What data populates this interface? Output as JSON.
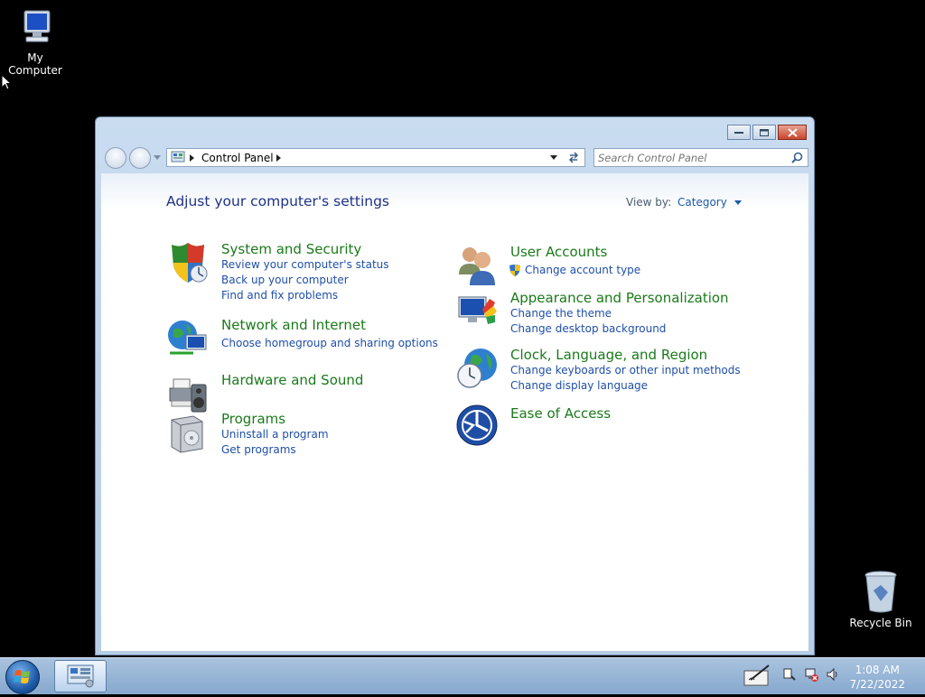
{
  "desktop": {
    "my_computer_label": "My Computer",
    "recycle_bin_label": "Recycle Bin"
  },
  "window": {
    "address_path": "Control Panel",
    "search_placeholder": "Search Control Panel",
    "title": "Adjust your computer's settings",
    "view_by_label": "View by:",
    "view_by_value": "Category"
  },
  "categories": {
    "system_security": {
      "title": "System and Security",
      "links": [
        "Review your computer's status",
        "Back up your computer",
        "Find and fix problems"
      ]
    },
    "network_internet": {
      "title": "Network and Internet",
      "links": [
        "Choose homegroup and sharing options"
      ]
    },
    "hardware_sound": {
      "title": "Hardware and Sound"
    },
    "programs": {
      "title": "Programs",
      "links": [
        "Uninstall a program",
        "Get programs"
      ]
    },
    "user_accounts": {
      "title": "User Accounts",
      "links": [
        "Change account type"
      ]
    },
    "appearance": {
      "title": "Appearance and Personalization",
      "links": [
        "Change the theme",
        "Change desktop background"
      ]
    },
    "clock_region": {
      "title": "Clock, Language, and Region",
      "links": [
        "Change keyboards or other input methods",
        "Change display language"
      ]
    },
    "ease_access": {
      "title": "Ease of Access"
    }
  },
  "taskbar": {
    "time": "1:08 AM",
    "date": "7/22/2022"
  },
  "colors": {
    "category_title": "#1a7a1a",
    "link": "#1f4fa8",
    "heading": "#1e3287"
  }
}
